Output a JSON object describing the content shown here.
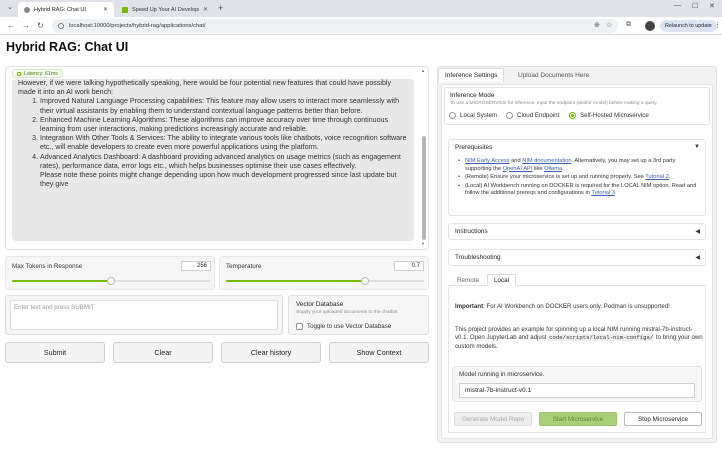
{
  "browser": {
    "tabs": [
      {
        "label": "Hybrid RAG: Chat UI",
        "active": true
      },
      {
        "label": "Speed Up Your AI Development",
        "active": false
      }
    ],
    "url": "localhost:10000/projects/hybrid-rag/applications/chat/",
    "relaunch_label": "Relaunch to update"
  },
  "app": {
    "title": "Hybrid RAG: Chat UI",
    "latency": "Latency: 61ms",
    "chat": {
      "intro": "However, if we were talking hypothetically speaking, here would be four potential new features that could have possibly made it into an AI work bench:",
      "items": [
        "Improved Natural Language Processing capabilities: This feature may allow users to interact more seamlessly with their virtual assistants by enabling them to understand contextual language patterns better than before.",
        "Enhanced Machine Learning Algorithms: These algorithms can improve accuracy over time through continuous learning from user interactions, making predictions increasingly accurate and reliable.",
        "Integration With Other Tools & Services: The ability to integrate various tools like chatbots, voice recognition software etc., will enable developers to create even more powerful applications using the platform.",
        "Advanced Analytics Dashboard: A dashboard providing advanced analytics on usage metrics (such as engagement rates), performance data, error logs etc., which helps businesses optimise their use cases effectively."
      ],
      "note": "Please note these points might change depending upon how much development progressed since last update but they give"
    },
    "max_tokens": {
      "label": "Max Tokens in Response",
      "value": "256",
      "fraction": 0.5
    },
    "temperature": {
      "label": "Temperature",
      "value": "0.7",
      "fraction": 0.7
    },
    "input_placeholder": "Enter text and press SUBMIT",
    "vector_db": {
      "title": "Vector Database",
      "subtitle": "Supply your uploaded documents to the chatbot",
      "toggle_label": "Toggle to use Vector Database"
    },
    "buttons": {
      "submit": "Submit",
      "clear": "Clear",
      "clear_history": "Clear history",
      "show_context": "Show Context"
    }
  },
  "settings": {
    "tabs": {
      "inference": "Inference Settings",
      "upload": "Upload Documents Here"
    },
    "inference_mode": {
      "title": "Inference Mode",
      "subtitle": "To use a MICROSERVICE for inference, input the endpoint (and/or model) before making a query.",
      "options": [
        "Local System",
        "Cloud Endpoint",
        "Self-Hosted Microservice"
      ],
      "selected": "Self-Hosted Microservice"
    },
    "prerequisites": {
      "title": "Prerequisites",
      "item1": {
        "link1": "NIM Early Access",
        "and": " and ",
        "link2": "NIM documentation",
        "text": ". Alternatively, you may set up a 3rd party supporting the ",
        "link3": "OpenAI API",
        "like": " like ",
        "link4": "Ollama",
        "end": "."
      },
      "item2": {
        "text": "(Remote) Ensure your microservice is set up and running properly. See ",
        "link": "Tutorial 2",
        "end": "."
      },
      "item3": {
        "text": "(Local) AI Workbench running on DOCKER is required for the LOCAL NIM option. Read and follow the additional prereqs and configurations in ",
        "link": "Tutorial 3",
        "end": "."
      }
    },
    "instructions": {
      "title": "Instructions"
    },
    "troubleshooting": {
      "title": "Troubleshooting"
    },
    "sub_tabs": {
      "remote": "Remote",
      "local": "Local"
    },
    "local": {
      "important_label": "Important",
      "important_text": ": For AI Workbench on DOCKER users only. Podman is unsupported!",
      "desc_1": "This project provides an example for spinning up a local NIM running mistral-7b-instruct-v0.1. Open JupyterLab and adjust ",
      "desc_code": "code/scripts/local-nim-configs/",
      "desc_2": " to bring your own custom models.",
      "model_label": "Model running in microservice.",
      "model_value": "mistral-7b-instruct-v0.1"
    },
    "actions": {
      "generate": "Generate Model Repo",
      "start": "Start Microservice",
      "stop": "Stop Microservice"
    }
  }
}
